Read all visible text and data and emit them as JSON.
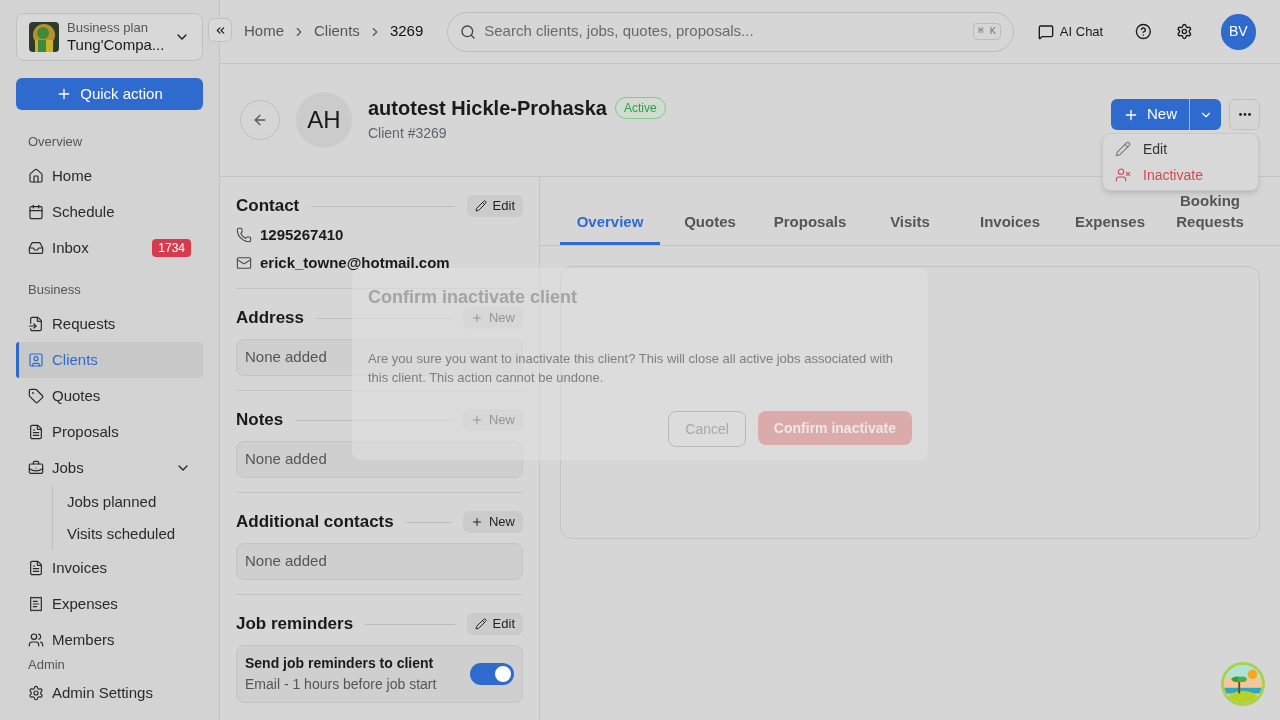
{
  "sidebar": {
    "org": {
      "plan": "Business plan",
      "name": "Tung'Compa..."
    },
    "quick_action": "Quick action",
    "sections": [
      {
        "title": "Overview",
        "items": [
          {
            "label": "Home",
            "selected": false
          },
          {
            "label": "Schedule",
            "selected": false
          },
          {
            "label": "Inbox",
            "selected": false,
            "badge": "1734"
          }
        ]
      },
      {
        "title": "Business",
        "items": [
          {
            "label": "Requests",
            "selected": false
          },
          {
            "label": "Clients",
            "selected": true
          },
          {
            "label": "Quotes",
            "selected": false
          },
          {
            "label": "Proposals",
            "selected": false
          },
          {
            "label": "Jobs",
            "selected": false,
            "expanded": true,
            "children": [
              {
                "label": "Jobs planned",
                "selected": false
              },
              {
                "label": "Visits scheduled",
                "selected": false
              }
            ]
          },
          {
            "label": "Invoices",
            "selected": false
          },
          {
            "label": "Expenses",
            "selected": false
          },
          {
            "label": "Members",
            "selected": false
          }
        ]
      }
    ],
    "admin": {
      "title": "Admin",
      "items": [
        {
          "label": "Admin Settings",
          "selected": false
        }
      ]
    }
  },
  "topbar": {
    "breadcrumbs": [
      "Home",
      "Clients",
      "3269"
    ],
    "search": {
      "placeholder": "Search clients, jobs, quotes, proposals...",
      "shortcut": "⌘ K"
    },
    "ai_chat": "AI Chat",
    "avatar": "BV"
  },
  "client": {
    "initials": "AH",
    "name": "autotest Hickle-Prohaska",
    "status": "Active",
    "number": "Client #3269",
    "new_button": "New"
  },
  "menu": [
    {
      "label": "Edit",
      "kind": "normal"
    },
    {
      "label": "Inactivate",
      "kind": "danger"
    }
  ],
  "sections": [
    {
      "title": "Contact",
      "action": "Edit",
      "kind": "edit",
      "lines": [
        {
          "kind": "phone",
          "text": "1295267410"
        },
        {
          "kind": "email",
          "text": "erick_towne@hotmail.com"
        }
      ]
    },
    {
      "title": "Address",
      "action": "New",
      "kind": "new",
      "empty": "None added"
    },
    {
      "title": "Notes",
      "action": "New",
      "kind": "new",
      "empty": "None added"
    },
    {
      "title": "Additional contacts",
      "action": "New",
      "kind": "new",
      "empty": "None added"
    },
    {
      "title": "Job reminders",
      "action": "Edit",
      "kind": "edit",
      "reminder": {
        "title": "Send job reminders to client",
        "detail": "Email - 1 hours before job start",
        "on": true
      }
    }
  ],
  "tabs": [
    {
      "label": "Overview",
      "selected": true
    },
    {
      "label": "Quotes",
      "selected": false
    },
    {
      "label": "Proposals",
      "selected": false
    },
    {
      "label": "Visits",
      "selected": false
    },
    {
      "label": "Invoices",
      "selected": false
    },
    {
      "label": "Expenses",
      "selected": false
    },
    {
      "label": "Booking Requests",
      "selected": false
    }
  ],
  "dialog": {
    "title": "Confirm inactivate client",
    "message": "Are you sure you want to inactivate this client? This will close all active jobs associated with this client. This action cannot be undone.",
    "cancel": "Cancel",
    "confirm": "Confirm inactivate"
  }
}
